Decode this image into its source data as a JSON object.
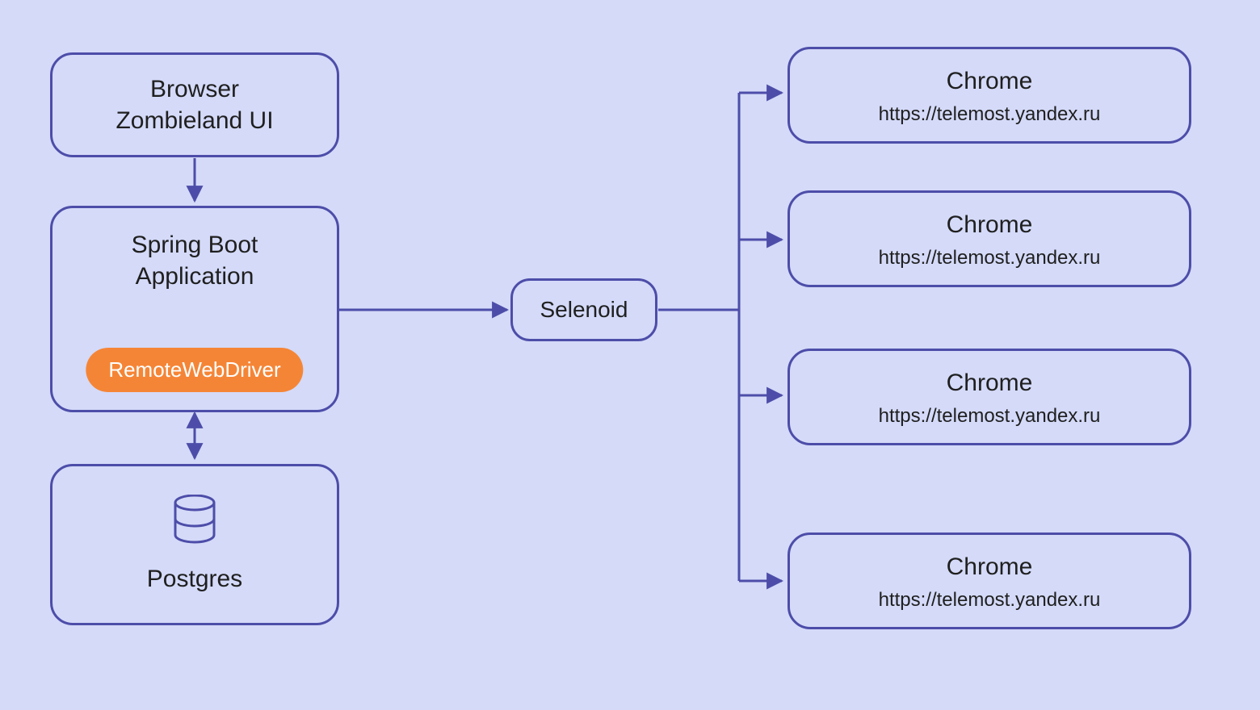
{
  "colors": {
    "bg": "#D4DAF8",
    "stroke": "#4D4DA9",
    "pill": "#F58536",
    "text": "#1f1f1f"
  },
  "browser": {
    "line1": "Browser",
    "line2": "Zombieland UI"
  },
  "spring": {
    "line1": "Spring Boot",
    "line2": "Application",
    "driver": "RemoteWebDriver"
  },
  "postgres": {
    "label": "Postgres"
  },
  "selenoid": {
    "label": "Selenoid"
  },
  "chrome": [
    {
      "title": "Chrome",
      "url": "https://telemost.yandex.ru"
    },
    {
      "title": "Chrome",
      "url": "https://telemost.yandex.ru"
    },
    {
      "title": "Chrome",
      "url": "https://telemost.yandex.ru"
    },
    {
      "title": "Chrome",
      "url": "https://telemost.yandex.ru"
    }
  ]
}
